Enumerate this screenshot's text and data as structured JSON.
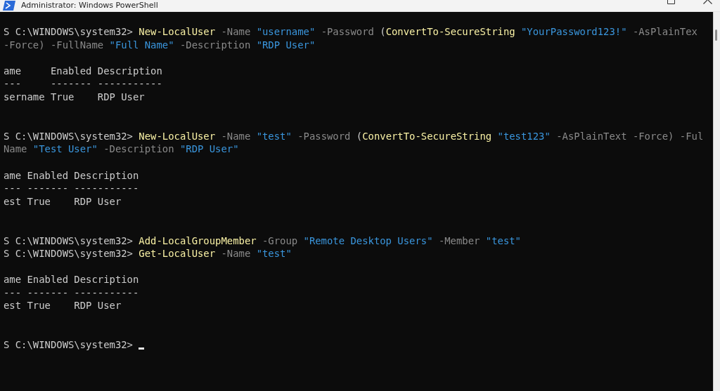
{
  "window": {
    "title": "Administrator: Windows PowerShell"
  },
  "terminal": {
    "lines": [
      {
        "kind": "command",
        "segments": [
          {
            "kind": "text",
            "text": "S C:\\WINDOWS\\system32> "
          },
          {
            "kind": "cmdlet",
            "text": "New-LocalUser"
          },
          {
            "kind": "param",
            "text": " -Name "
          },
          {
            "kind": "string",
            "text": "\"username\""
          },
          {
            "kind": "param",
            "text": " -Password "
          },
          {
            "kind": "text",
            "text": "("
          },
          {
            "kind": "cmdlet",
            "text": "ConvertTo-SecureString"
          },
          {
            "kind": "string",
            "text": " \"YourPassword123!\""
          },
          {
            "kind": "param",
            "text": " -AsPlainTex"
          }
        ]
      },
      {
        "kind": "command",
        "segments": [
          {
            "kind": "param",
            "text": "-Force) -FullName "
          },
          {
            "kind": "string",
            "text": "\"Full Name\""
          },
          {
            "kind": "param",
            "text": " -Description "
          },
          {
            "kind": "string",
            "text": "\"RDP User\""
          }
        ]
      },
      {
        "kind": "output",
        "segments": [
          {
            "kind": "text",
            "text": "ame     Enabled Description"
          }
        ]
      },
      {
        "kind": "output",
        "segments": [
          {
            "kind": "text",
            "text": "---     ------- -----------"
          }
        ]
      },
      {
        "kind": "output",
        "segments": [
          {
            "kind": "text",
            "text": "sername True    RDP User"
          }
        ]
      },
      {
        "kind": "command",
        "segments": [
          {
            "kind": "text",
            "text": "S C:\\WINDOWS\\system32> "
          },
          {
            "kind": "cmdlet",
            "text": "New-LocalUser"
          },
          {
            "kind": "param",
            "text": " -Name "
          },
          {
            "kind": "string",
            "text": "\"test\""
          },
          {
            "kind": "param",
            "text": " -Password "
          },
          {
            "kind": "text",
            "text": "("
          },
          {
            "kind": "cmdlet",
            "text": "ConvertTo-SecureString"
          },
          {
            "kind": "string",
            "text": " \"test123\""
          },
          {
            "kind": "param",
            "text": " -AsPlainText -Force) -Ful"
          }
        ]
      },
      {
        "kind": "command",
        "segments": [
          {
            "kind": "param",
            "text": "Name "
          },
          {
            "kind": "string",
            "text": "\"Test User\""
          },
          {
            "kind": "param",
            "text": " -Description "
          },
          {
            "kind": "string",
            "text": "\"RDP User\""
          }
        ]
      },
      {
        "kind": "output",
        "segments": [
          {
            "kind": "text",
            "text": "ame Enabled Description"
          }
        ]
      },
      {
        "kind": "output",
        "segments": [
          {
            "kind": "text",
            "text": "--- ------- -----------"
          }
        ]
      },
      {
        "kind": "output",
        "segments": [
          {
            "kind": "text",
            "text": "est True    RDP User"
          }
        ]
      },
      {
        "kind": "command",
        "segments": [
          {
            "kind": "text",
            "text": "S C:\\WINDOWS\\system32> "
          },
          {
            "kind": "cmdlet",
            "text": "Add-LocalGroupMember"
          },
          {
            "kind": "param",
            "text": " -Group "
          },
          {
            "kind": "string",
            "text": "\"Remote Desktop Users\""
          },
          {
            "kind": "param",
            "text": " -Member "
          },
          {
            "kind": "string",
            "text": "\"test\""
          }
        ]
      },
      {
        "kind": "command",
        "segments": [
          {
            "kind": "text",
            "text": "S C:\\WINDOWS\\system32> "
          },
          {
            "kind": "cmdlet",
            "text": "Get-LocalUser"
          },
          {
            "kind": "param",
            "text": " -Name "
          },
          {
            "kind": "string",
            "text": "\"test\""
          }
        ]
      },
      {
        "kind": "output",
        "segments": [
          {
            "kind": "text",
            "text": "ame Enabled Description"
          }
        ]
      },
      {
        "kind": "output",
        "segments": [
          {
            "kind": "text",
            "text": "--- ------- -----------"
          }
        ]
      },
      {
        "kind": "output",
        "segments": [
          {
            "kind": "text",
            "text": "est True    RDP User"
          }
        ]
      },
      {
        "kind": "command",
        "cursor": true,
        "segments": [
          {
            "kind": "text",
            "text": "S C:\\WINDOWS\\system32> "
          }
        ]
      }
    ]
  }
}
